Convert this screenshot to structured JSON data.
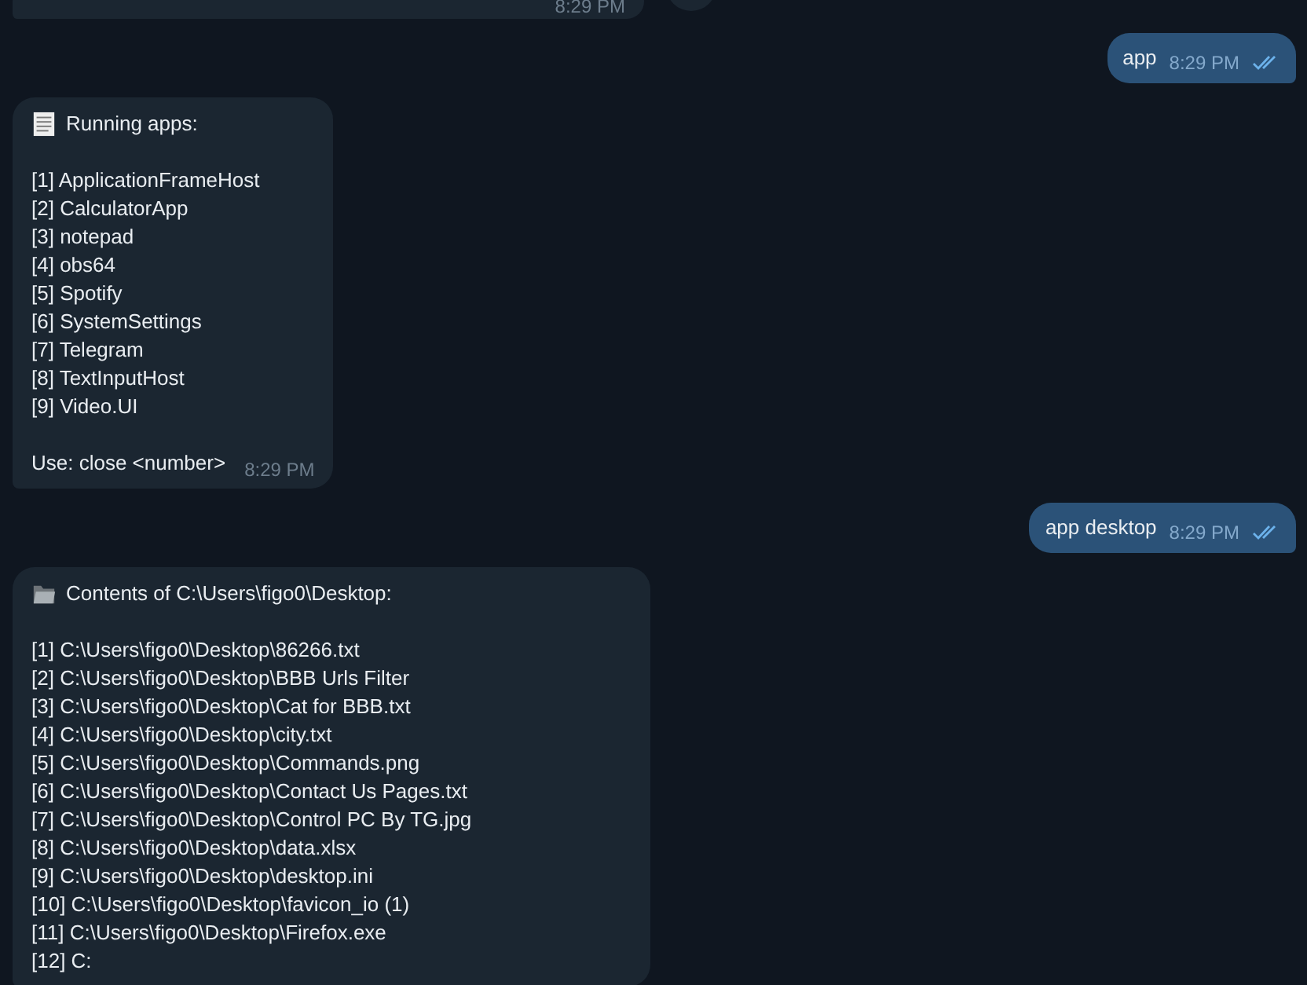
{
  "messages": [
    {
      "kind": "incoming",
      "time": "8:29 PM"
    },
    {
      "kind": "outgoing",
      "text": "app",
      "time": "8:29 PM",
      "read": true
    },
    {
      "kind": "incoming",
      "title": "Running apps:",
      "lines": [
        "[1] ApplicationFrameHost",
        "[2] CalculatorApp",
        "[3] notepad",
        "[4] obs64",
        "[5] Spotify",
        "[6] SystemSettings",
        "[7] Telegram",
        "[8] TextInputHost",
        "[9] Video.UI"
      ],
      "footer": "Use: close <number>",
      "time": "8:29 PM"
    },
    {
      "kind": "outgoing",
      "text": "app desktop",
      "time": "8:29 PM",
      "read": true
    },
    {
      "kind": "incoming",
      "title": "Contents of C:\\Users\\figo0\\Desktop:",
      "lines": [
        "[1] C:\\Users\\figo0\\Desktop\\86266.txt",
        "[2] C:\\Users\\figo0\\Desktop\\BBB Urls Filter",
        "[3] C:\\Users\\figo0\\Desktop\\Cat for BBB.txt",
        "[4] C:\\Users\\figo0\\Desktop\\city.txt",
        "[5] C:\\Users\\figo0\\Desktop\\Commands.png",
        "[6] C:\\Users\\figo0\\Desktop\\Contact Us Pages.txt",
        "[7] C:\\Users\\figo0\\Desktop\\Control PC By TG.jpg",
        "[8] C:\\Users\\figo0\\Desktop\\data.xlsx",
        "[9] C:\\Users\\figo0\\Desktop\\desktop.ini",
        "[10] C:\\Users\\figo0\\Desktop\\favicon_io (1)",
        "[11] C:\\Users\\figo0\\Desktop\\Firefox.exe",
        "[12] C:"
      ]
    }
  ]
}
